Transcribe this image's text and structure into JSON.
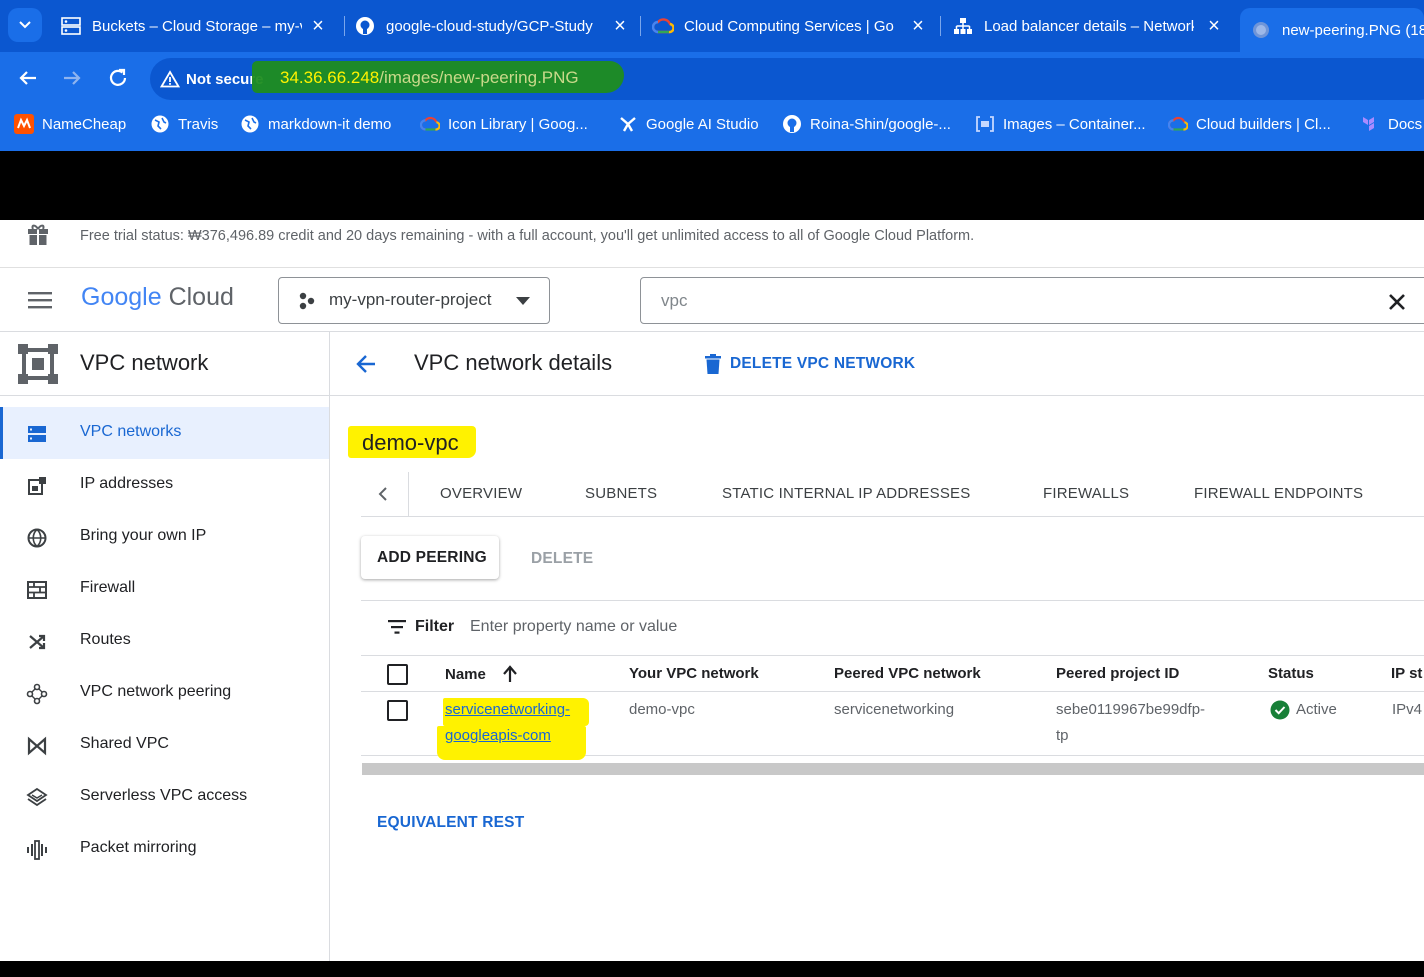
{
  "browser": {
    "tabs": [
      {
        "title": "Buckets – Cloud Storage – my-v",
        "icon": "storage-icon"
      },
      {
        "title": "google-cloud-study/GCP-Study",
        "icon": "github-icon"
      },
      {
        "title": "Cloud Computing Services | Go",
        "icon": "google-cloud-icon"
      },
      {
        "title": "Load balancer details – Network",
        "icon": "network-icon"
      },
      {
        "title": "new-peering.PNG (18",
        "icon": "globe-icon"
      }
    ],
    "security_label": "Not secure",
    "url_host": "34.36.66.248",
    "url_path": "/images/new-peering.PNG",
    "bookmarks": [
      "NameCheap",
      "Travis",
      "markdown-it demo",
      "Icon Library | Goog...",
      "Google AI Studio",
      "Roina-Shin/google-...",
      "Images – Container...",
      "Cloud builders | Cl...",
      "Docs"
    ]
  },
  "banner": {
    "text": "Free trial status: ₩376,496.89 credit and 20 days remaining - with a full account, you'll get unlimited access to all of Google Cloud Platform."
  },
  "header": {
    "logo_google": "Google",
    "logo_cloud": "Cloud",
    "project": "my-vpn-router-project",
    "search_value": "vpc"
  },
  "sidebar": {
    "title": "VPC network",
    "items": [
      {
        "label": "VPC networks",
        "icon": "vpc-networks-icon",
        "active": true
      },
      {
        "label": "IP addresses",
        "icon": "ip-addresses-icon"
      },
      {
        "label": "Bring your own IP",
        "icon": "globe-icon"
      },
      {
        "label": "Firewall",
        "icon": "firewall-icon"
      },
      {
        "label": "Routes",
        "icon": "routes-icon"
      },
      {
        "label": "VPC network peering",
        "icon": "peering-icon"
      },
      {
        "label": "Shared VPC",
        "icon": "shared-vpc-icon"
      },
      {
        "label": "Serverless VPC access",
        "icon": "serverless-icon"
      },
      {
        "label": "Packet mirroring",
        "icon": "packet-mirroring-icon"
      }
    ]
  },
  "main": {
    "title": "VPC network details",
    "delete_label": "DELETE VPC NETWORK",
    "network_name": "demo-vpc",
    "tabs": [
      "OVERVIEW",
      "SUBNETS",
      "STATIC INTERNAL IP ADDRESSES",
      "FIREWALLS",
      "FIREWALL ENDPOINTS"
    ],
    "add_peering_label": "ADD PEERING",
    "delete_label2": "DELETE",
    "filter_label": "Filter",
    "filter_placeholder": "Enter property name or value",
    "columns": [
      "Name",
      "Your VPC network",
      "Peered VPC network",
      "Peered project ID",
      "Status",
      "IP st"
    ],
    "rows": [
      {
        "name_line1": "servicenetworking-",
        "name_line2": "googleapis-com",
        "your_vpc": "demo-vpc",
        "peered_vpc": "servicenetworking",
        "project_line1": "sebe0119967be99dfp-",
        "project_line2": "tp",
        "status": "Active",
        "ip_stack": "IPv4"
      }
    ],
    "equivalent_rest": "EQUIVALENT REST"
  },
  "colors": {
    "chrome_blue": "#0b57d0",
    "chrome_blue_light": "#1a6ee8",
    "gcp_blue": "#1967d2",
    "highlight": "#fff200",
    "status_green": "#188038"
  }
}
